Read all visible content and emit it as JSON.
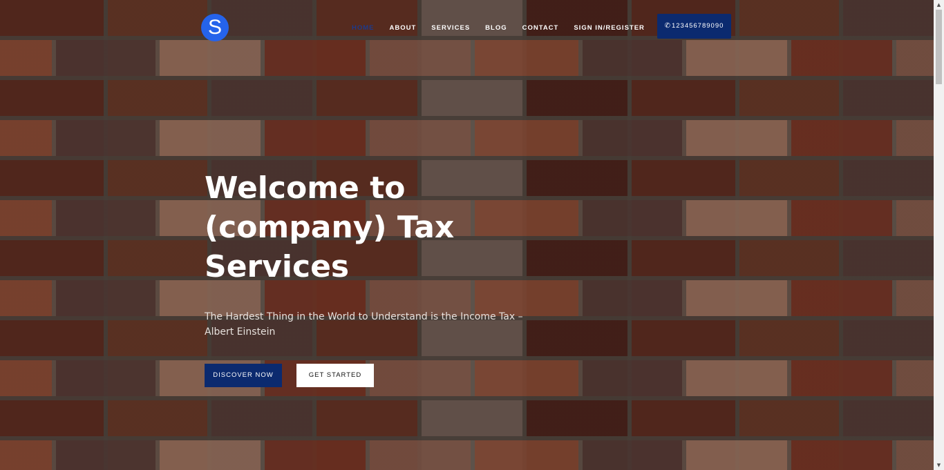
{
  "brand": {
    "logo_letter": "S",
    "logo_color": "#2563eb"
  },
  "nav": {
    "items": [
      {
        "label": "HOME",
        "active": true
      },
      {
        "label": "ABOUT",
        "active": false
      },
      {
        "label": "SERVICES",
        "active": false
      },
      {
        "label": "BLOG",
        "active": false
      },
      {
        "label": "CONTACT",
        "active": false
      },
      {
        "label": "SIGN IN/REGISTER",
        "active": false
      }
    ],
    "phone": {
      "icon": "phone-icon",
      "number": "123456789090"
    }
  },
  "hero": {
    "title": "Welcome to (company) Tax Services",
    "subtitle": "The Hardest Thing in the World to Understand is the Income Tax – Albert Einstein",
    "primary_button": "DISCOVER NOW",
    "secondary_button": "GET STARTED",
    "background": "brick-wall-image"
  },
  "colors": {
    "accent": "#0b2a6f",
    "active_nav": "#1e3a8a",
    "text_light": "#ffffff"
  },
  "scrollbar": {
    "up_icon": "scroll-up-arrow-icon",
    "down_icon": "scroll-down-arrow-icon"
  }
}
